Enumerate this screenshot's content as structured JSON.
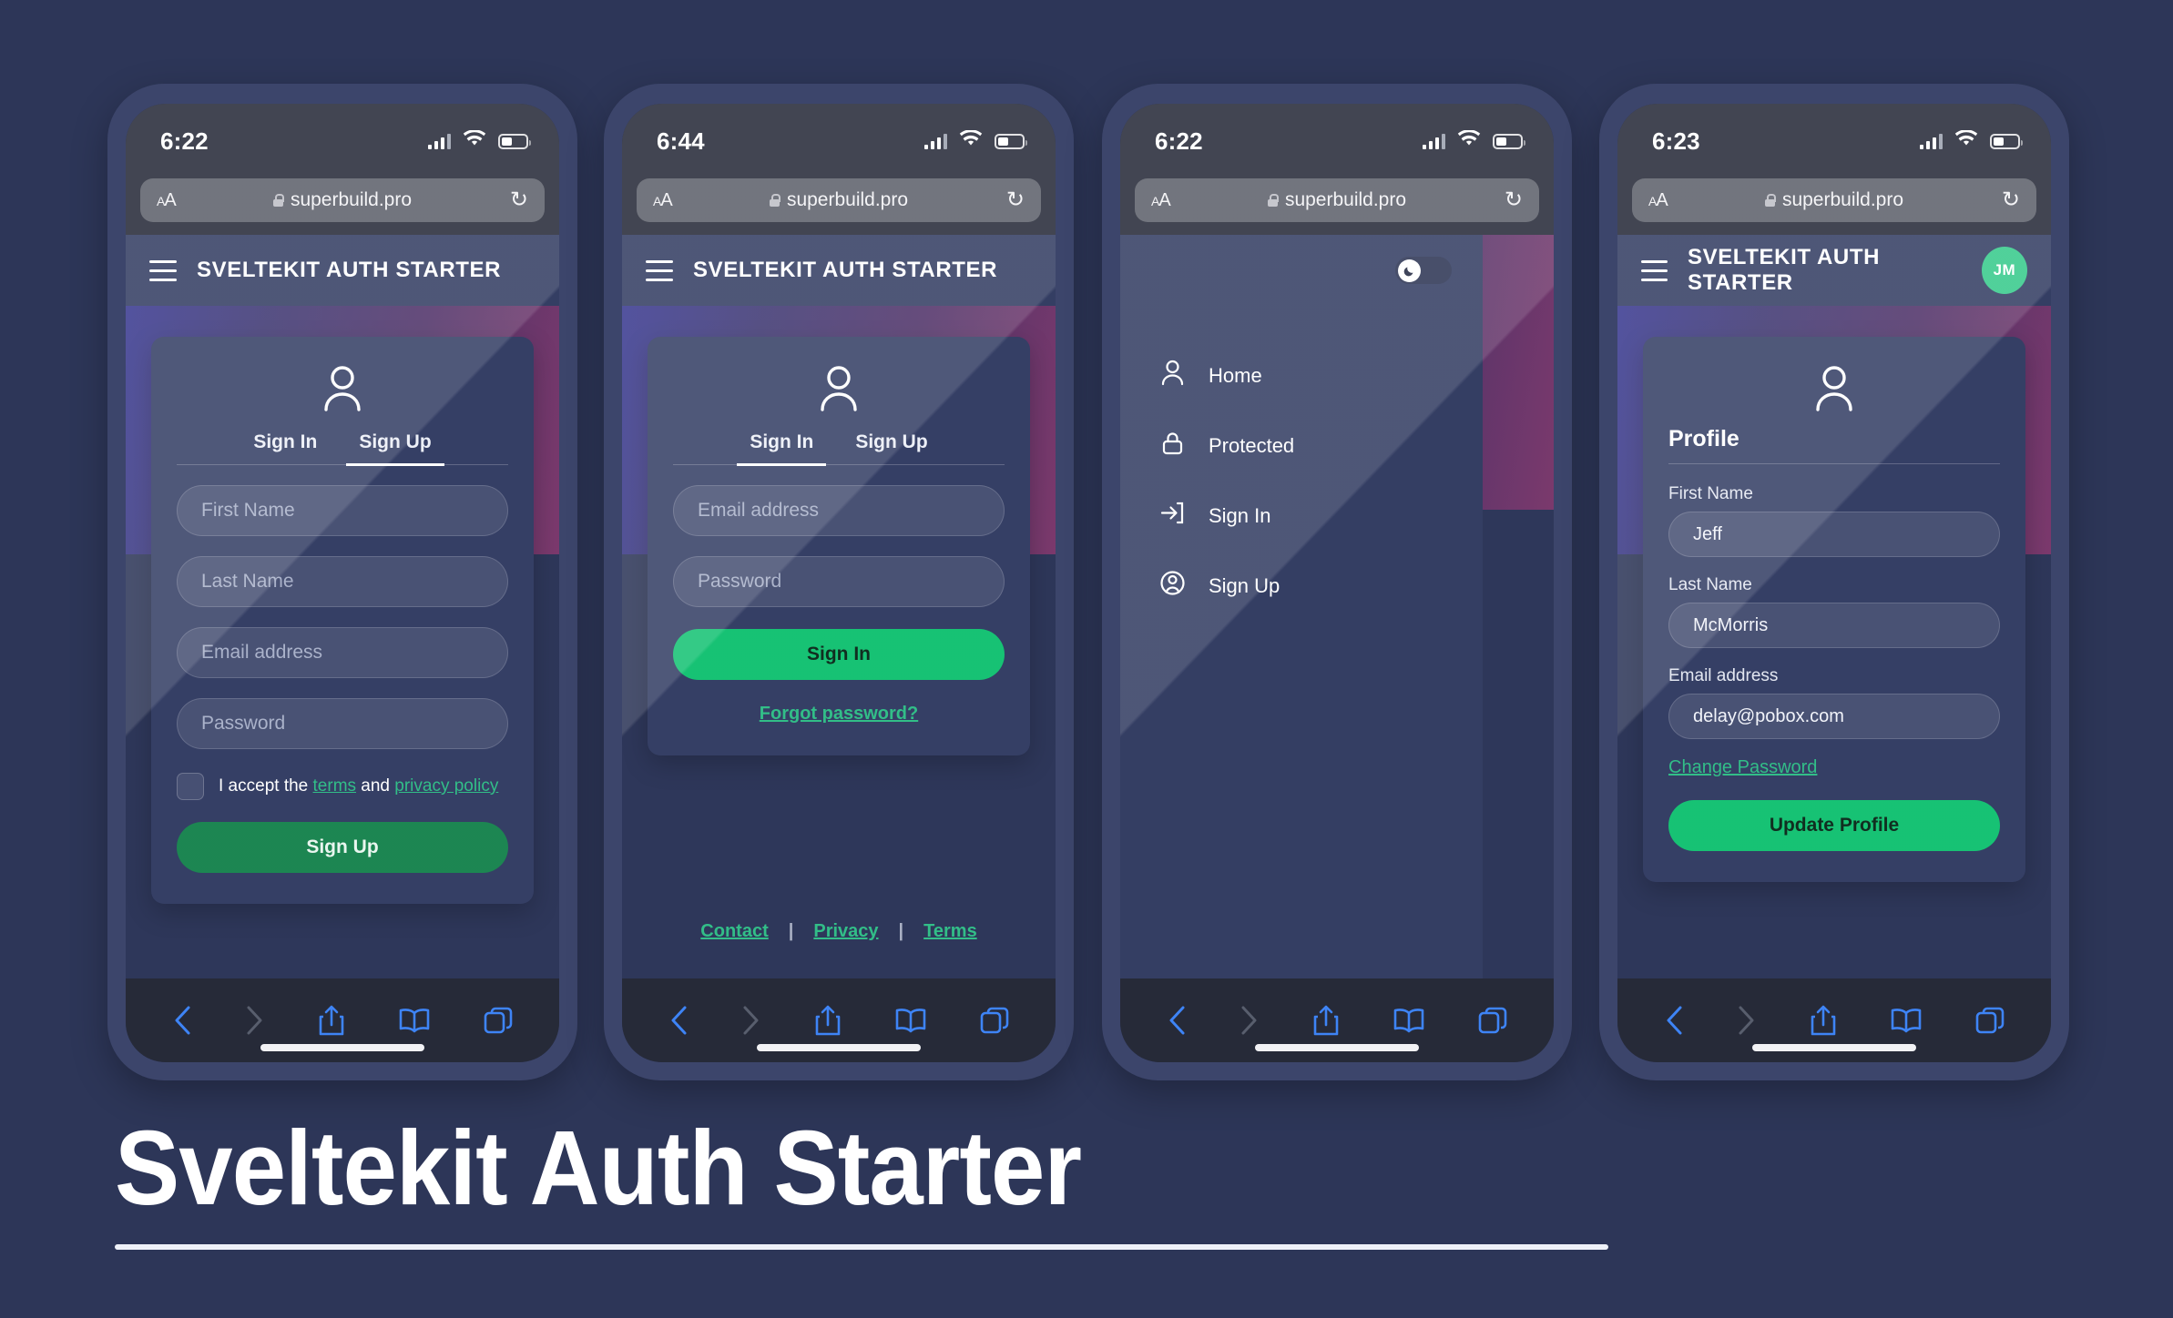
{
  "background_color": "#2d3658",
  "accent_green": "#13c172",
  "headline": {
    "text": "Sveltekit Auth Starter"
  },
  "browser": {
    "aa_label": "AA",
    "url": "superbuild.pro",
    "reload_glyph": "↻",
    "toolbar": {
      "back": "back-icon",
      "forward": "forward-icon",
      "share": "share-icon",
      "bookmarks": "book-icon",
      "tabs": "tabs-icon"
    }
  },
  "app": {
    "title": "SVELTEKIT AUTH STARTER"
  },
  "phones": [
    {
      "id": "signup",
      "status_time": "6:22",
      "tabs": [
        {
          "label": "Sign In",
          "active": false
        },
        {
          "label": "Sign Up",
          "active": true
        }
      ],
      "fields": [
        {
          "placeholder": "First Name",
          "value": ""
        },
        {
          "placeholder": "Last Name",
          "value": ""
        },
        {
          "placeholder": "Email address",
          "value": ""
        },
        {
          "placeholder": "Password",
          "value": ""
        }
      ],
      "terms": {
        "prefix": "I accept the ",
        "terms_link": "terms",
        "middle": " and ",
        "privacy_link": "privacy policy"
      },
      "submit_label": "Sign Up"
    },
    {
      "id": "signin",
      "status_time": "6:44",
      "tabs": [
        {
          "label": "Sign In",
          "active": true
        },
        {
          "label": "Sign Up",
          "active": false
        }
      ],
      "fields": [
        {
          "placeholder": "Email address",
          "value": ""
        },
        {
          "placeholder": "Password",
          "value": ""
        }
      ],
      "submit_label": "Sign In",
      "forgot_label": "Forgot password?",
      "footer_links": [
        "Contact",
        "Privacy",
        "Terms"
      ],
      "footer_separator": "|"
    },
    {
      "id": "menu",
      "status_time": "6:22",
      "dark_mode_toggle": {
        "icon": "moon-icon",
        "on": false
      },
      "menu_items": [
        {
          "icon": "person-icon",
          "label": "Home"
        },
        {
          "icon": "lock-icon",
          "label": "Protected"
        },
        {
          "icon": "sign-in-icon",
          "label": "Sign In"
        },
        {
          "icon": "user-circle-icon",
          "label": "Sign Up"
        }
      ]
    },
    {
      "id": "profile",
      "status_time": "6:23",
      "avatar_initials": "JM",
      "heading": "Profile",
      "fields": [
        {
          "label": "First Name",
          "value": "Jeff"
        },
        {
          "label": "Last Name",
          "value": "McMorris"
        },
        {
          "label": "Email address",
          "value": "delay@pobox.com"
        }
      ],
      "change_password_label": "Change Password",
      "submit_label": "Update Profile"
    }
  ]
}
